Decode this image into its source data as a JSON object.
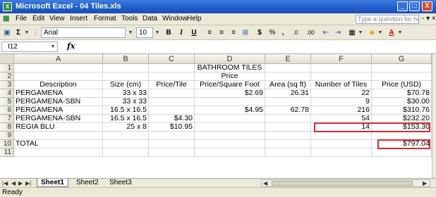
{
  "window": {
    "title": "Microsoft Excel - 04 Tiles.xls",
    "app_icon": "X",
    "minimize_label": "_",
    "restore_label": "□",
    "close_label": "X"
  },
  "menu": {
    "items": [
      "File",
      "Edit",
      "View",
      "Insert",
      "Format",
      "Tools",
      "Data",
      "Window",
      "Help"
    ],
    "question_placeholder": "Type a question for help",
    "doc_controls": "- ▾ ×"
  },
  "toolbar": {
    "autosum": "Σ",
    "font": "Arial",
    "size": "10",
    "bold": "B",
    "italic": "I",
    "underline": "U",
    "currency": "$",
    "percent": "%",
    "comma": ",",
    "inc_decimal": ".0",
    "dec_decimal": ".00",
    "font_color": "A"
  },
  "formula_bar": {
    "name_box": "I12",
    "fx": "fx",
    "content": ""
  },
  "sheet": {
    "columns": [
      "A",
      "B",
      "C",
      "D",
      "E",
      "F",
      "G"
    ],
    "rows": [
      {
        "num": "1",
        "cells": [
          "",
          "",
          "",
          "BATHROOM TILES",
          "",
          "",
          ""
        ]
      },
      {
        "num": "2",
        "cells": [
          "",
          "",
          "",
          "Price",
          "",
          "",
          ""
        ]
      },
      {
        "num": "3",
        "cells": [
          "Description",
          "Size (cm)",
          "Price/Tile",
          "Price/Square Foot",
          "Area (sq ft)",
          "Number of Tiles",
          "Price (USD)"
        ]
      },
      {
        "num": "4",
        "cells": [
          "PERGAMENA",
          "33 x 33",
          "",
          "$2.69",
          "26.31",
          "22",
          "$70.78"
        ]
      },
      {
        "num": "5",
        "cells": [
          "PERGAMENA-SBN",
          "33 x 33",
          "",
          "",
          "",
          "9",
          "$30.00"
        ]
      },
      {
        "num": "6",
        "cells": [
          "PERGAMENA",
          "16.5 x 16.5",
          "",
          "$4.95",
          "62.78",
          "216",
          "$310.76"
        ]
      },
      {
        "num": "7",
        "cells": [
          "PERGAMENA-SBN",
          "16.5 x 16.5",
          "$4.30",
          "",
          "",
          "54",
          "$232.20"
        ]
      },
      {
        "num": "8",
        "cells": [
          "REGIA BLU",
          "25 x 8",
          "$10.95",
          "",
          "",
          "14",
          "$153.30"
        ]
      },
      {
        "num": "9",
        "cells": [
          "",
          "",
          "",
          "",
          "",
          "",
          ""
        ]
      },
      {
        "num": "10",
        "cells": [
          "TOTAL",
          "",
          "",
          "",
          "",
          "",
          "$797.04"
        ]
      },
      {
        "num": "11",
        "cells": [
          "",
          "",
          "",
          "",
          "",
          "",
          ""
        ]
      }
    ]
  },
  "tabs": {
    "nav": [
      "|◀",
      "◀",
      "▶",
      "▶|"
    ],
    "sheets": [
      "Sheet1",
      "Sheet2",
      "Sheet3"
    ],
    "active": "Sheet1"
  },
  "status": {
    "text": "Ready"
  },
  "colors": {
    "titlebar": "#1f5bc9",
    "highlight_border": "#e0262f",
    "chrome": "#ece9d8"
  }
}
